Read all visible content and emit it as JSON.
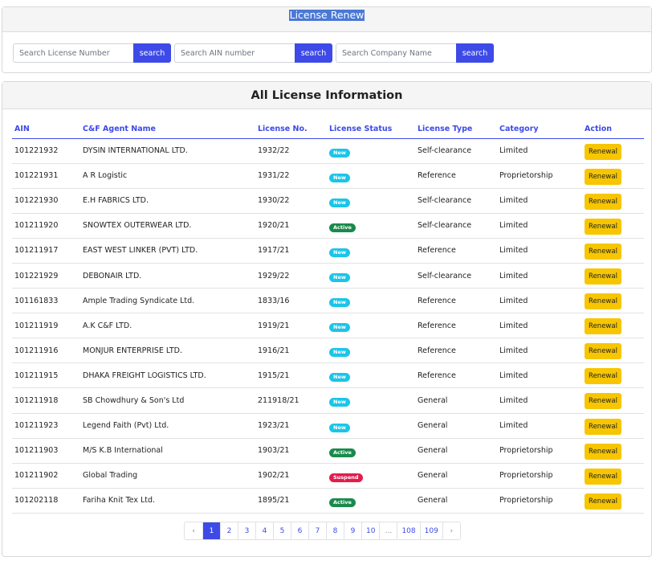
{
  "renew_section": {
    "title": "License Renew",
    "searches": [
      {
        "placeholder": "Search License Number",
        "button": "search"
      },
      {
        "placeholder": "Search AIN number",
        "button": "search"
      },
      {
        "placeholder": "Search Company Name",
        "button": "search"
      }
    ]
  },
  "list_section": {
    "title": "All License Information",
    "columns": [
      "AIN",
      "C&F Agent Name",
      "License No.",
      "License Status",
      "License Type",
      "Category",
      "Action"
    ],
    "rows": [
      {
        "ain": "101221932",
        "name": "DYSIN INTERNATIONAL LTD.",
        "license": "1932/22",
        "status": "New",
        "type": "Self-clearance",
        "category": "Limited",
        "action": "Renewal"
      },
      {
        "ain": "101221931",
        "name": "A R Logistic",
        "license": "1931/22",
        "status": "New",
        "type": "Reference",
        "category": "Proprietorship",
        "action": "Renewal"
      },
      {
        "ain": "101221930",
        "name": "E.H FABRICS LTD.",
        "license": "1930/22",
        "status": "New",
        "type": "Self-clearance",
        "category": "Limited",
        "action": "Renewal"
      },
      {
        "ain": "101211920",
        "name": "SNOWTEX OUTERWEAR LTD.",
        "license": "1920/21",
        "status": "Active",
        "type": "Self-clearance",
        "category": "Limited",
        "action": "Renewal"
      },
      {
        "ain": "101211917",
        "name": "EAST WEST LINKER (PVT) LTD.",
        "license": "1917/21",
        "status": "New",
        "type": "Reference",
        "category": "Limited",
        "action": "Renewal"
      },
      {
        "ain": "101221929",
        "name": "DEBONAIR LTD.",
        "license": "1929/22",
        "status": "New",
        "type": "Self-clearance",
        "category": "Limited",
        "action": "Renewal"
      },
      {
        "ain": "101161833",
        "name": "Ample Trading Syndicate Ltd.",
        "license": "1833/16",
        "status": "New",
        "type": "Reference",
        "category": "Limited",
        "action": "Renewal"
      },
      {
        "ain": "101211919",
        "name": "A.K C&F LTD.",
        "license": "1919/21",
        "status": "New",
        "type": "Reference",
        "category": "Limited",
        "action": "Renewal"
      },
      {
        "ain": "101211916",
        "name": "MONJUR ENTERPRISE LTD.",
        "license": "1916/21",
        "status": "New",
        "type": "Reference",
        "category": "Limited",
        "action": "Renewal"
      },
      {
        "ain": "101211915",
        "name": "DHAKA FREIGHT LOGISTICS LTD.",
        "license": "1915/21",
        "status": "New",
        "type": "Reference",
        "category": "Limited",
        "action": "Renewal"
      },
      {
        "ain": "101211918",
        "name": "SB Chowdhury & Son's Ltd",
        "license": "211918/21",
        "status": "New",
        "type": "General",
        "category": "Limited",
        "action": "Renewal"
      },
      {
        "ain": "101211923",
        "name": "Legend Faith (Pvt) Ltd.",
        "license": "1923/21",
        "status": "New",
        "type": "General",
        "category": "Limited",
        "action": "Renewal"
      },
      {
        "ain": "101211903",
        "name": "M/S K.B International",
        "license": "1903/21",
        "status": "Active",
        "type": "General",
        "category": "Proprietorship",
        "action": "Renewal"
      },
      {
        "ain": "101211902",
        "name": "Global Trading",
        "license": "1902/21",
        "status": "Suspend",
        "type": "General",
        "category": "Proprietorship",
        "action": "Renewal"
      },
      {
        "ain": "101202118",
        "name": "Fariha Knit Tex Ltd.",
        "license": "1895/21",
        "status": "Active",
        "type": "General",
        "category": "Proprietorship",
        "action": "Renewal"
      }
    ]
  },
  "status_colors": {
    "New": "#1bc5e8",
    "Active": "#1a8a4c",
    "Suspend": "#e21d4d"
  },
  "accent_color": "#3d4ae8",
  "pagination": {
    "prev": "‹",
    "pages": [
      "1",
      "2",
      "3",
      "4",
      "5",
      "6",
      "7",
      "8",
      "9",
      "10",
      "...",
      "108",
      "109"
    ],
    "next": "›",
    "active": "1"
  }
}
